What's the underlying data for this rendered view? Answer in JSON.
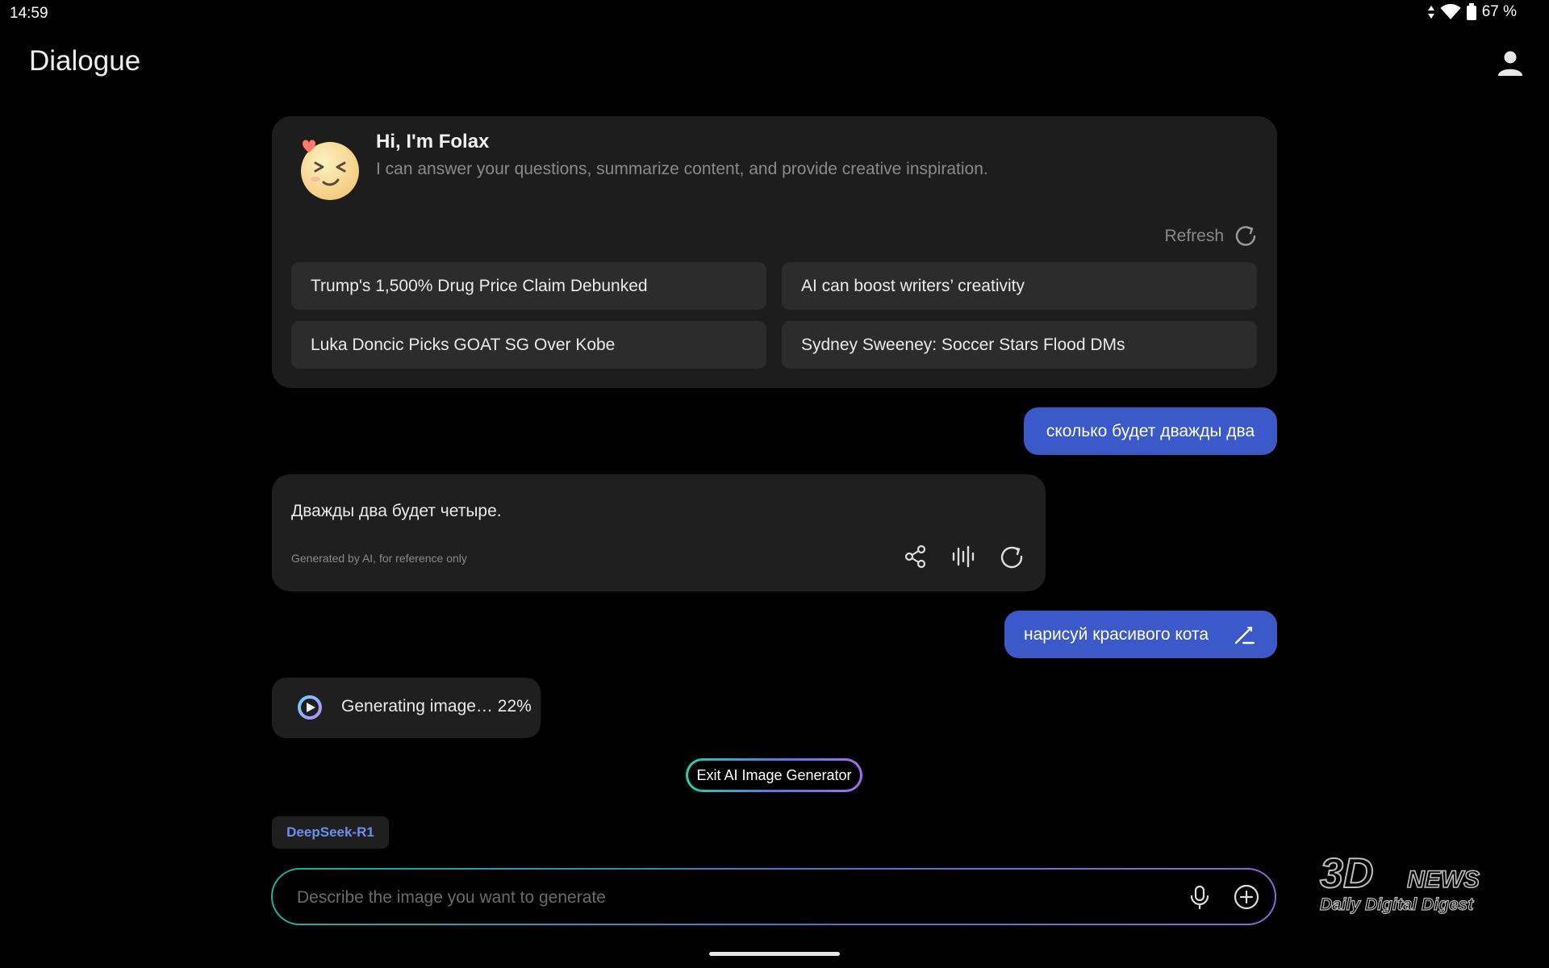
{
  "status": {
    "time": "14:59",
    "battery": "67 %"
  },
  "header": {
    "title": "Dialogue",
    "profile_icon": "person-icon"
  },
  "intro": {
    "title": "Hi, I'm Folax",
    "subtitle": "I can answer your questions, summarize content, and provide creative inspiration.",
    "refresh_label": "Refresh",
    "suggestions": [
      "Trump's 1,500% Drug Price Claim Debunked",
      "AI can boost writers’ creativity",
      "Luka Doncic Picks GOAT SG Over Kobe",
      "Sydney Sweeney: Soccer Stars Flood DMs"
    ]
  },
  "messages": {
    "user1": "сколько будет дважды два",
    "answer": "Дважды два будет четыре.",
    "disclaimer": "Generated by AI, for reference only",
    "user2": "нарисуй красивого кота",
    "generating": "Generating image… 22%",
    "progress_percent": 22
  },
  "controls": {
    "exit_label": "Exit AI Image Generator",
    "model": "DeepSeek-R1",
    "input_placeholder": "Describe the image you want to generate"
  },
  "watermark": {
    "brand": "3DNEWS",
    "tagline": "Daily Digital Digest"
  },
  "colors": {
    "accent": "#3b59c9",
    "model_text": "#6f8ff0",
    "card": "#1d1d1d"
  }
}
